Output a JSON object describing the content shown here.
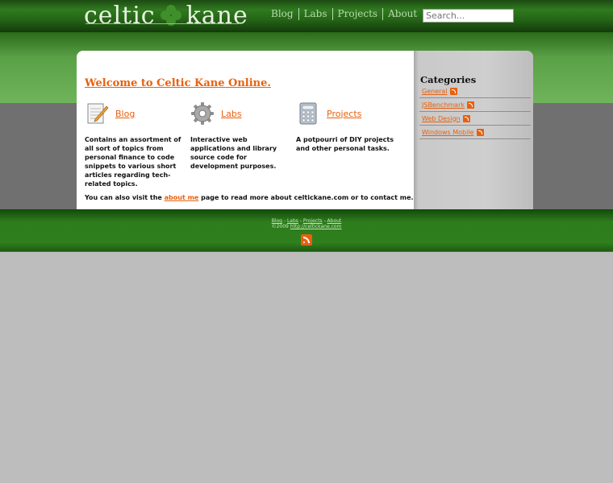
{
  "header": {
    "logo_left": "celtic",
    "logo_right": "kane",
    "nav": [
      "Blog",
      "Labs",
      "Projects",
      "About"
    ],
    "search_placeholder": "Search..."
  },
  "main": {
    "welcome": "Welcome to Celtic Kane Online.",
    "sections": [
      {
        "label": "Blog",
        "icon": "notepad-pencil-icon",
        "desc": "Contains an assortment of all sort of topics from personal finance to code snippets to various short articles regarding tech-related topics."
      },
      {
        "label": "Labs",
        "icon": "gear-icon",
        "desc": "Interactive web applications and library source code for development purposes."
      },
      {
        "label": "Projects",
        "icon": "calculator-icon",
        "desc": "A potpourri of DIY projects and other personal tasks."
      }
    ],
    "about_prefix": "You can also visit the ",
    "about_link": "about me",
    "about_suffix": " page to read more about celtickane.com or to contact me."
  },
  "sidebar": {
    "title": "Categories",
    "categories": [
      "General",
      "JSBenchmark",
      "Web Design",
      "Windows Mobile"
    ]
  },
  "footer": {
    "links": [
      "Blog",
      "Labs",
      "Projects",
      "About"
    ],
    "separator": " - ",
    "copyright": "©2009 ",
    "site_link": "http://celtickane.com"
  },
  "colors": {
    "accent": "#e8600e",
    "header_green": "#2f7a1f",
    "text": "#111111"
  }
}
